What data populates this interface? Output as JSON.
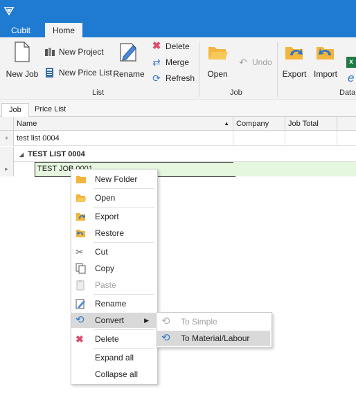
{
  "ribbon_tabs": [
    "Cubit",
    "Home"
  ],
  "ribbon": {
    "new_job": "New Job",
    "new_project": "New Project",
    "new_price_list": "New Price List",
    "rename": "Rename",
    "delete": "Delete",
    "merge": "Merge",
    "refresh": "Refresh",
    "open": "Open",
    "undo": "Undo",
    "export": "Export",
    "import": "Import",
    "groups": {
      "list": "List",
      "job": "Job",
      "data": "Data"
    }
  },
  "doc_tabs": [
    "Job",
    "Price List"
  ],
  "grid": {
    "columns": [
      "Name",
      "Company",
      "Job Total"
    ],
    "filter_value": "test list 0004",
    "group_row": "TEST LIST 0004",
    "selected_row": "TEST JOB 0001"
  },
  "context_menu": {
    "items": [
      "New Folder",
      "Open",
      "Export",
      "Restore",
      "Cut",
      "Copy",
      "Paste",
      "Rename",
      "Convert",
      "Delete",
      "Expand all",
      "Collapse all"
    ]
  },
  "submenu": {
    "items": [
      "To Simple",
      "To Material/Labour"
    ]
  },
  "colors": {
    "titlebar": "#1e7bd1",
    "selection": "#e6f7e0",
    "hover": "#d9d9d9"
  }
}
